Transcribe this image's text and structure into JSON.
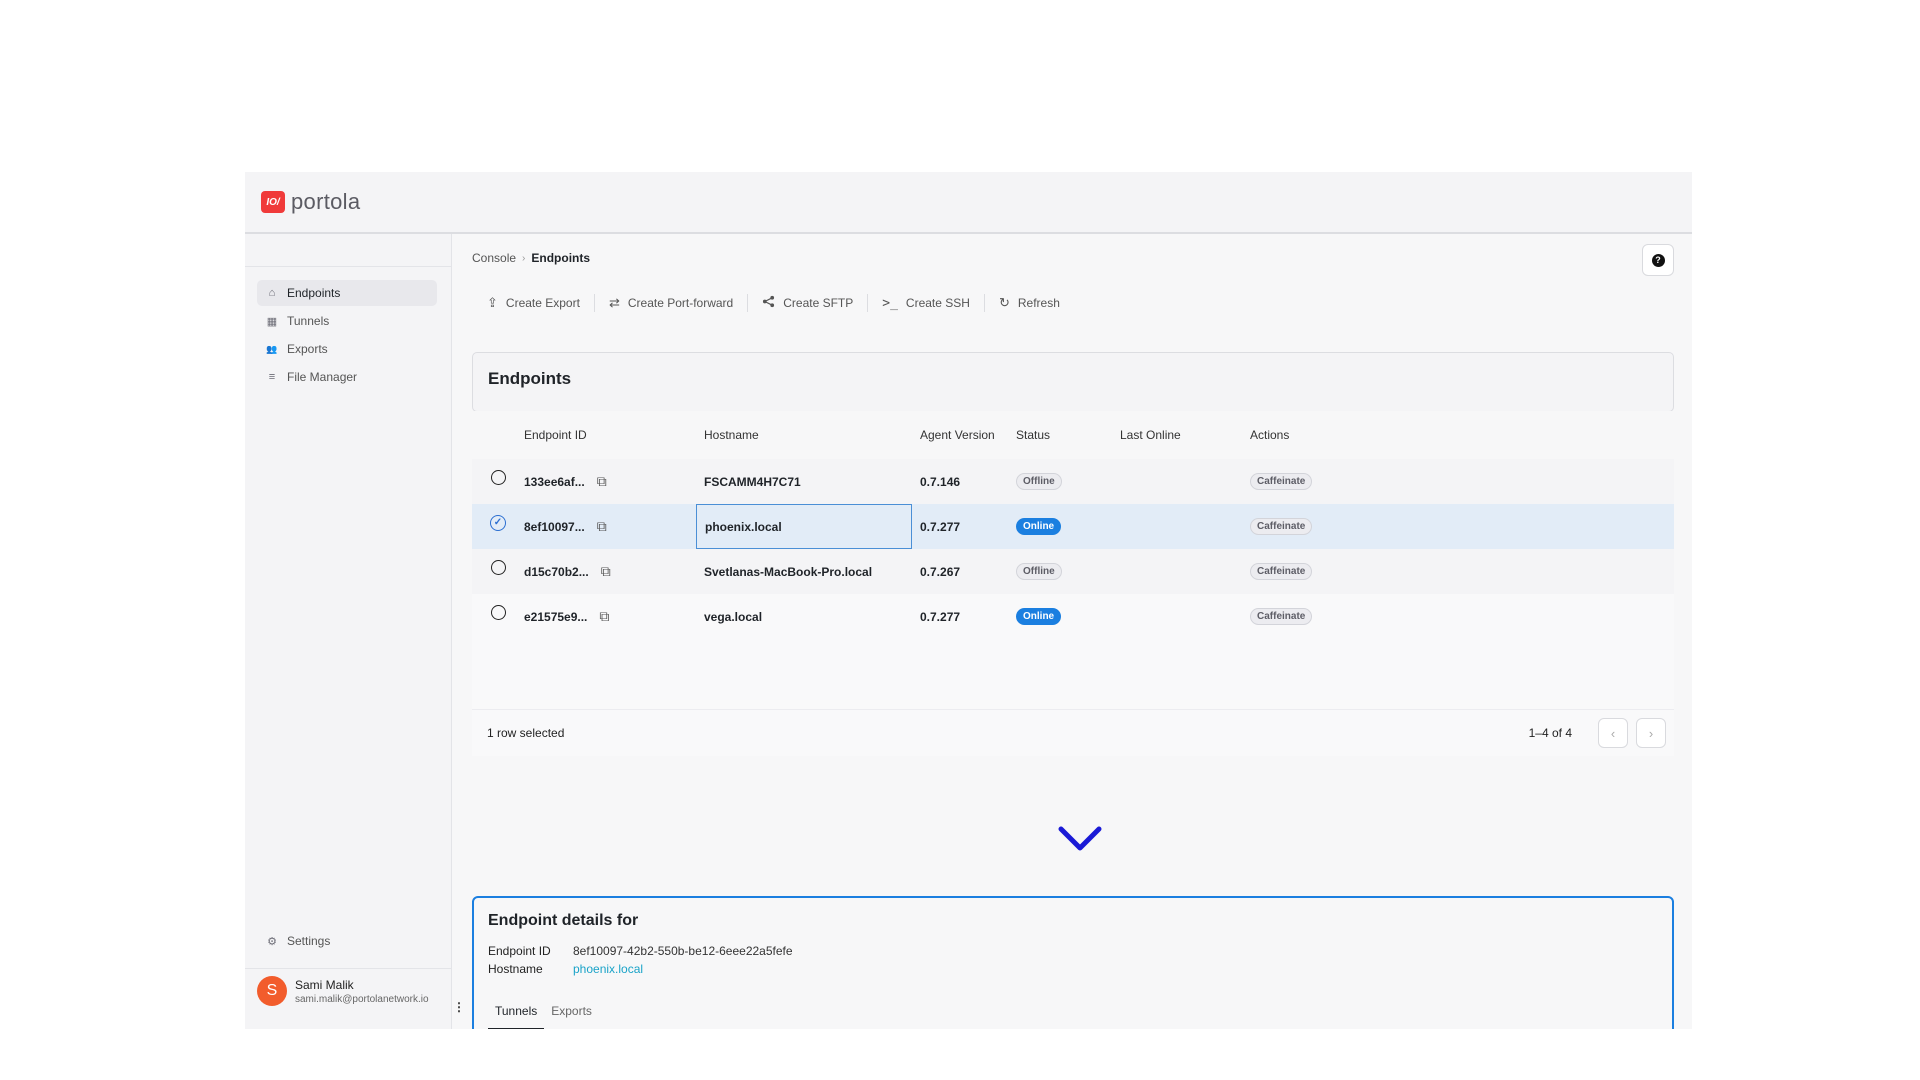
{
  "app": {
    "logo_mark": "IO/",
    "logo_text": "portola"
  },
  "sidebar": {
    "items": [
      {
        "label": "Endpoints",
        "icon": "home-icon",
        "glyph": "⌂",
        "active": true
      },
      {
        "label": "Tunnels",
        "icon": "chart-icon",
        "glyph": "▦",
        "active": false
      },
      {
        "label": "Exports",
        "icon": "people-icon",
        "glyph": "👥",
        "active": false
      },
      {
        "label": "File Manager",
        "icon": "storage-icon",
        "glyph": "≡",
        "active": false
      }
    ],
    "settings_label": "Settings",
    "user": {
      "initial": "S",
      "name": "Sami Malik",
      "email": "sami.malik@portolanetwork.io"
    }
  },
  "breadcrumb": {
    "root": "Console",
    "current": "Endpoints"
  },
  "toolbar": {
    "create_export": "Create Export",
    "create_port_forward": "Create Port-forward",
    "create_sftp": "Create SFTP",
    "create_ssh": "Create SSH",
    "refresh": "Refresh"
  },
  "endpoints": {
    "title": "Endpoints",
    "columns": {
      "id": "Endpoint ID",
      "hostname": "Hostname",
      "agent": "Agent Version",
      "status": "Status",
      "last_online": "Last Online",
      "actions": "Actions"
    },
    "rows": [
      {
        "id": "133ee6af...",
        "hostname": "FSCAMM4H7C71",
        "version": "0.7.146",
        "status": "Offline",
        "last_online": "",
        "action": "Caffeinate",
        "selected": false
      },
      {
        "id": "8ef10097...",
        "hostname": "phoenix.local",
        "version": "0.7.277",
        "status": "Online",
        "last_online": "",
        "action": "Caffeinate",
        "selected": true
      },
      {
        "id": "d15c70b2...",
        "hostname": "Svetlanas-MacBook-Pro.local",
        "version": "0.7.267",
        "status": "Offline",
        "last_online": "",
        "action": "Caffeinate",
        "selected": false
      },
      {
        "id": "e21575e9...",
        "hostname": "vega.local",
        "version": "0.7.277",
        "status": "Online",
        "last_online": "",
        "action": "Caffeinate",
        "selected": false
      }
    ],
    "footer": {
      "selected_text": "1 row selected",
      "pagination": "1–4 of 4"
    }
  },
  "details": {
    "title": "Endpoint details for",
    "id_label": "Endpoint ID",
    "id_value": "8ef10097-42b2-550b-be12-6eee22a5fefe",
    "hostname_label": "Hostname",
    "hostname_value": "phoenix.local",
    "tabs": [
      "Tunnels",
      "Exports"
    ]
  },
  "colors": {
    "accent": "#1b7fe0",
    "brand": "#f03a3a",
    "avatar": "#f25c2c",
    "chevron": "#1a1ad6"
  }
}
